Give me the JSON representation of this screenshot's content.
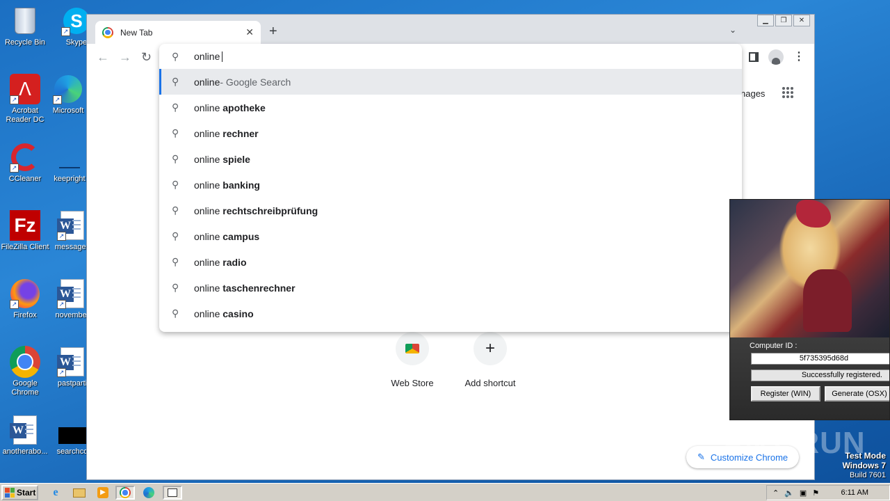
{
  "desktop": {
    "icons": [
      {
        "label": "Recycle Bin"
      },
      {
        "label": "Skype"
      },
      {
        "label": "Acrobat Reader DC"
      },
      {
        "label": "Microsoft"
      },
      {
        "label": "CCleaner"
      },
      {
        "label": "keepright"
      },
      {
        "label": "FileZilla Client"
      },
      {
        "label": "messages"
      },
      {
        "label": "Firefox"
      },
      {
        "label": "november"
      },
      {
        "label": "Google Chrome"
      },
      {
        "label": "pastparti"
      },
      {
        "label": "anotherabo..."
      },
      {
        "label": "searchco"
      }
    ]
  },
  "browser": {
    "tab_title": "New Tab",
    "tab_close": "✕",
    "new_tab": "+",
    "tab_search": "⌄",
    "window_controls": [
      "▁",
      "❐",
      "✕"
    ],
    "nav": {
      "back": "←",
      "forward": "→",
      "reload": "↻"
    },
    "ntp": {
      "images_link": "nages",
      "shortcuts": [
        {
          "label": "Web Store"
        },
        {
          "label": "Add shortcut",
          "glyph": "+"
        }
      ],
      "customize_label": "Customize Chrome"
    },
    "omnibox": {
      "query": "online ",
      "suggestions": [
        {
          "prefix": "online",
          "rest": " - Google Search",
          "selected": true
        },
        {
          "prefix": "online ",
          "rest": "apotheke"
        },
        {
          "prefix": "online ",
          "rest": "rechner"
        },
        {
          "prefix": "online ",
          "rest": "spiele"
        },
        {
          "prefix": "online ",
          "rest": "banking"
        },
        {
          "prefix": "online ",
          "rest": "rechtschreibprüfung"
        },
        {
          "prefix": "online ",
          "rest": "campus"
        },
        {
          "prefix": "online ",
          "rest": "radio"
        },
        {
          "prefix": "online ",
          "rest": "taschenrechner"
        },
        {
          "prefix": "online ",
          "rest": "casino"
        }
      ]
    }
  },
  "popup": {
    "computer_id_label": "Computer ID :",
    "computer_id_value": "5f735395d68d",
    "status": "Successfully registered.",
    "register_button": "Register (WIN)",
    "generate_button": "Generate (OSX)"
  },
  "watermark": "ANY  RUN",
  "system": {
    "test_mode": "Test Mode",
    "os": "Windows 7",
    "build": "Build 7601",
    "start_label": "Start",
    "clock": "6:11 AM"
  },
  "colors": {
    "accent": "#1a73e8",
    "desktop": "#1f74c6"
  }
}
